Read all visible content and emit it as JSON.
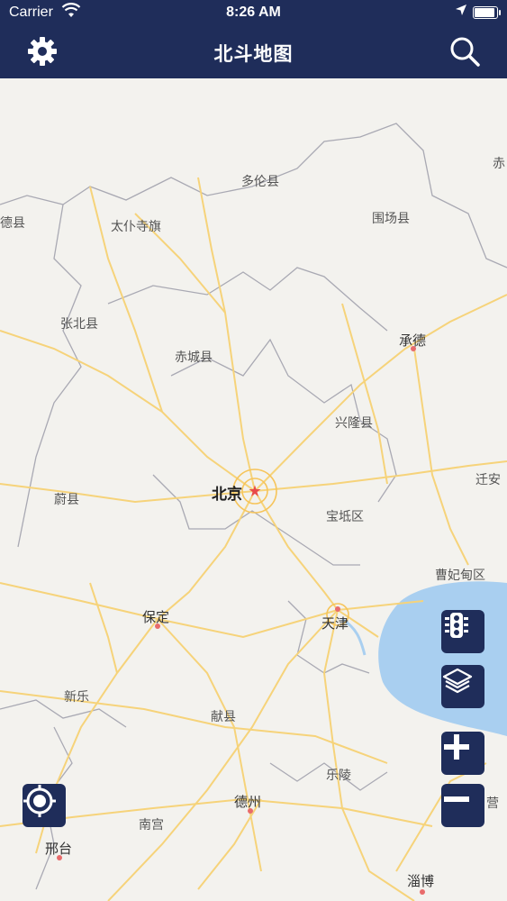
{
  "status_bar": {
    "carrier": "Carrier",
    "time": "8:26 AM"
  },
  "navbar": {
    "title": "北斗地图"
  },
  "map": {
    "labels": {
      "beijing": "北京",
      "tianjin": "天津",
      "baoding": "保定",
      "chengde": "承德",
      "duolun": "多伦县",
      "taipusi": "太仆寺旗",
      "weichang": "围场县",
      "zhangbei": "张北县",
      "chicheng": "赤城县",
      "xinglong": "兴隆县",
      "weixian": "蔚县",
      "baodi": "宝坻区",
      "caofeidian": "曹妃甸区",
      "qianan": "迁安",
      "xinle": "新乐",
      "xianxian": "献县",
      "leling": "乐陵",
      "dezhou": "德州",
      "nangong": "南宫",
      "xingtai": "邢台",
      "zibo": "淄博",
      "edge_dexian": "德县",
      "edge_chi": "赤",
      "edge_ying": "营"
    }
  },
  "controls": {
    "traffic": "traffic-icon",
    "layers": "layers-icon",
    "zoom_in": "plus-icon",
    "zoom_out": "minus-icon",
    "locate": "locate-icon"
  },
  "colors": {
    "nav": "#1f2d5a",
    "sea": "#a9cff0",
    "road": "#f6d37a",
    "city_dot": "#e86b6b"
  }
}
